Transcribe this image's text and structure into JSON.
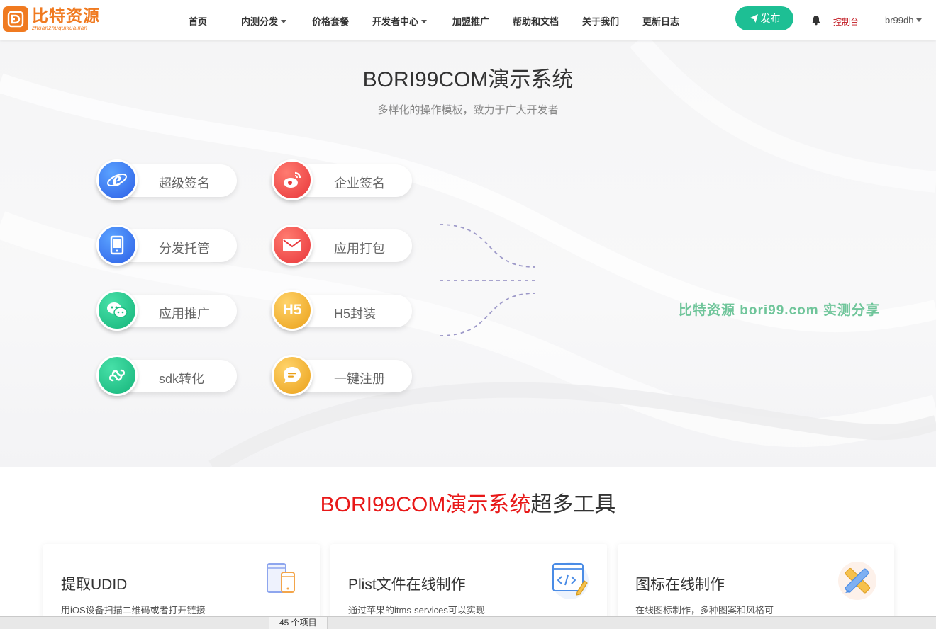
{
  "brand": {
    "title": "比特资源",
    "subtitle": "zhuanzhuquikuaiilan",
    "accent_color": "#f07a20"
  },
  "nav": {
    "items": [
      {
        "label": "首页",
        "has_dropdown": false
      },
      {
        "label": "内测分发",
        "has_dropdown": true
      },
      {
        "label": "价格套餐",
        "has_dropdown": false
      },
      {
        "label": "开发者中心",
        "has_dropdown": true
      },
      {
        "label": "加盟推广",
        "has_dropdown": false
      },
      {
        "label": "帮助和文档",
        "has_dropdown": false
      },
      {
        "label": "关于我们",
        "has_dropdown": false
      },
      {
        "label": "更新日志",
        "has_dropdown": false
      }
    ],
    "publish_label": "发布",
    "publish_color": "#1dbf94",
    "console_label": "控制台",
    "username": "br99dh"
  },
  "hero": {
    "title": "BORI99COM演示系统",
    "subtitle": "多样化的操作模板，致力于广大开发者",
    "features": [
      {
        "label": "超级签名",
        "icon": "ie-browser-icon",
        "color": "blue"
      },
      {
        "label": "企业签名",
        "icon": "weibo-icon",
        "color": "red"
      },
      {
        "label": "分发托管",
        "icon": "tablet-icon",
        "color": "blue"
      },
      {
        "label": "应用打包",
        "icon": "mail-icon",
        "color": "red"
      },
      {
        "label": "应用推广",
        "icon": "wechat-icon",
        "color": "green"
      },
      {
        "label": "H5封装",
        "icon": "h5-icon",
        "color": "orange"
      },
      {
        "label": "sdk转化",
        "icon": "mini-program-icon",
        "color": "green"
      },
      {
        "label": "一键注册",
        "icon": "chat-bubble-icon",
        "color": "orange"
      }
    ],
    "h5_badge": "H5",
    "watermark": "比特资源 bori99.com 实测分享"
  },
  "tools": {
    "title_accent": "BORI99COM演示系统",
    "title_rest": "超多工具",
    "cards": [
      {
        "title": "提取UDID",
        "desc": "用iOS设备扫描二维码或者打开链接",
        "icon": "devices-icon"
      },
      {
        "title": "Plist文件在线制作",
        "desc": "通过苹果的itms-services可以实现",
        "icon": "code-editor-icon"
      },
      {
        "title": "图标在线制作",
        "desc": "在线图标制作，多种图案和风格可",
        "icon": "pencil-ruler-icon"
      }
    ]
  },
  "taskbar": {
    "item_label": "45 个项目"
  }
}
